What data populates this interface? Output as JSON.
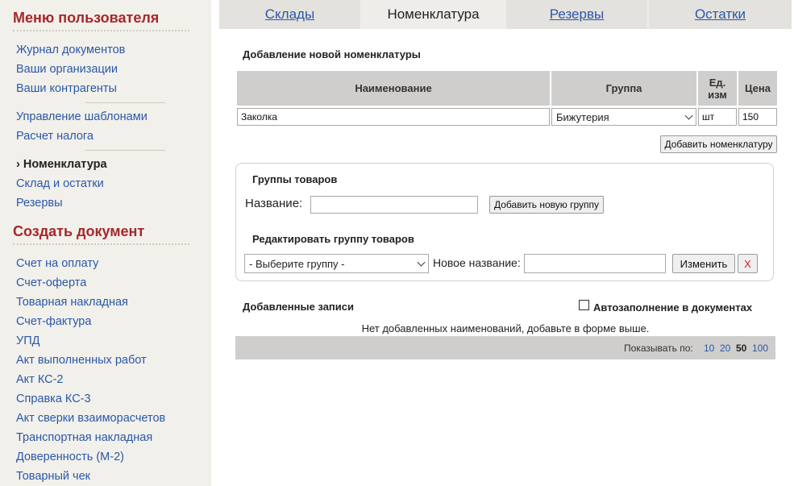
{
  "sidebar": {
    "menu_title": "Меню пользователя",
    "links": [
      "Журнал документов",
      "Ваши организации",
      "Ваши контрагенты",
      "Управление шаблонами",
      "Расчет налога"
    ],
    "active_marker": "›",
    "active_item": "Номенклатура",
    "links2": [
      "Склад и остатки",
      "Резервы"
    ],
    "create_title": "Создать документ",
    "docs": [
      "Счет на оплату",
      "Счет-оферта",
      "Товарная накладная",
      "Счет-фактура",
      "УПД",
      "Акт выполненных работ",
      "Акт КС-2",
      "Справка КС-3",
      "Акт сверки взаиморасчетов",
      "Транспортная накладная",
      "Доверенность (М-2)",
      "Товарный чек"
    ]
  },
  "tabs": [
    "Склады",
    "Номенклатура",
    "Резервы",
    "Остатки"
  ],
  "add_section": {
    "title": "Добавление новой номенклатуры",
    "headers": {
      "name": "Наименование",
      "group": "Группа",
      "unit_line1": "Ед.",
      "unit_line2": "изм",
      "price": "Цена"
    },
    "row": {
      "name": "Заколка",
      "group": "Бижутерия",
      "unit": "шт",
      "price": "150"
    },
    "add_button": "Добавить номенклатуру"
  },
  "groups_panel": {
    "title": "Группы товаров",
    "name_label": "Название:",
    "name_value": "",
    "add_group_button": "Добавить новую группу",
    "edit_title": "Редактировать группу товаров",
    "select_value": "- Выберите группу -",
    "new_name_label": "Новое название:",
    "new_name_value": "",
    "change_button": "Изменить",
    "delete_button": "X"
  },
  "records": {
    "title": "Добавленные записи",
    "autofill_label": "Автозаполнение в документах",
    "autofill_checked": false,
    "empty_message": "Нет добавленных наименований, добавьте в форме выше.",
    "show_label": "Показывать по:",
    "page_sizes": [
      "10",
      "20",
      "50",
      "100"
    ],
    "current_page_size": "50"
  },
  "colors": {
    "accent": "#a5282b",
    "link": "#2a58a8",
    "sidebar_bg": "#f2f0eb",
    "header_bg": "#cfcecc"
  }
}
